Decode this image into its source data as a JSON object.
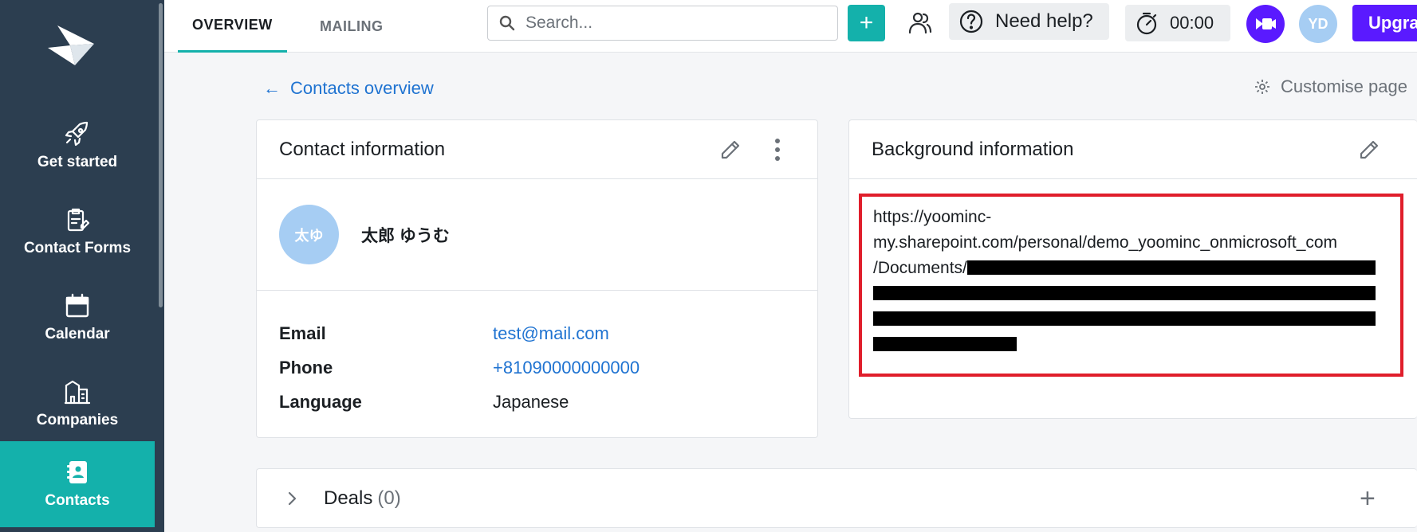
{
  "sidebar": {
    "items": [
      {
        "label": "Get started",
        "icon": "rocket-icon"
      },
      {
        "label": "Contact Forms",
        "icon": "form-icon"
      },
      {
        "label": "Calendar",
        "icon": "calendar-icon"
      },
      {
        "label": "Companies",
        "icon": "building-icon"
      },
      {
        "label": "Contacts",
        "icon": "address-book-icon",
        "active": true
      }
    ]
  },
  "topbar": {
    "tabs": [
      {
        "label": "OVERVIEW",
        "active": true
      },
      {
        "label": "MAILING",
        "active": false
      }
    ],
    "search_placeholder": "Search...",
    "add_label": "+",
    "help_label": "Need help?",
    "timer_label": "00:00",
    "user_initials": "YD",
    "upgrade_label": "Upgrade"
  },
  "main": {
    "back_link": "Contacts overview",
    "customise_label": "Customise page",
    "contact_card": {
      "title": "Contact information",
      "avatar_initials": "太ゆ",
      "name": "太郎 ゆうむ",
      "fields": [
        {
          "label": "Email",
          "value": "test@mail.com",
          "link": true
        },
        {
          "label": "Phone",
          "value": "+81090000000000",
          "link": true
        },
        {
          "label": "Language",
          "value": "Japanese",
          "link": false
        }
      ]
    },
    "background_card": {
      "title": "Background information",
      "url_line1": "https://yoominc-",
      "url_line2": "my.sharepoint.com/personal/demo_yoominc_onmicrosoft_com",
      "url_line3": "/Documents/"
    },
    "deals": {
      "title": "Deals",
      "count": "(0)"
    }
  },
  "colors": {
    "sidebar_bg": "#2c3e50",
    "accent": "#14b1ab",
    "link": "#1f73d1",
    "brand_purple": "#5a1aff",
    "highlight_box": "#e01e2b"
  }
}
